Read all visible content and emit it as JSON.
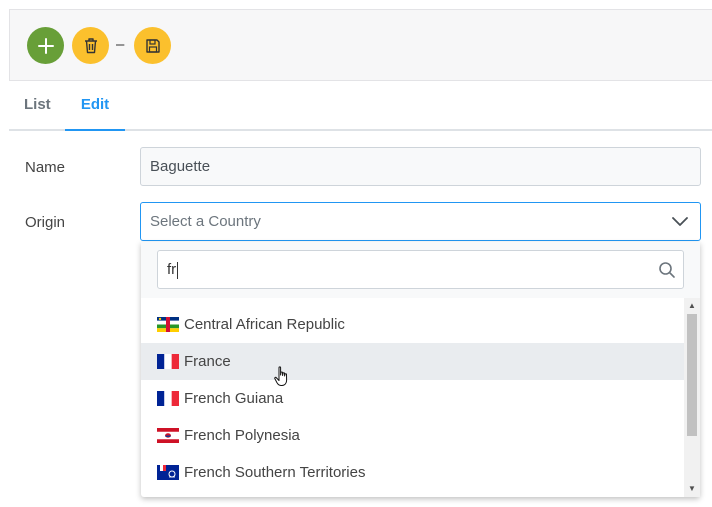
{
  "toolbar": {
    "add_icon": "plus-icon",
    "delete_icon": "trash-icon",
    "separator": "–",
    "save_icon": "save-icon",
    "colors": {
      "add": "#689f38",
      "warning": "#fbc02d"
    }
  },
  "tabs": [
    {
      "label": "List"
    },
    {
      "label": "Edit"
    }
  ],
  "form": {
    "name_label": "Name",
    "name_value": "Baguette",
    "origin_label": "Origin",
    "origin_placeholder": "Select a Country"
  },
  "dropdown": {
    "filter_value": "fr",
    "items": [
      {
        "label": "Central African Republic",
        "flag": "cf-flag-icon"
      },
      {
        "label": "France",
        "flag": "fr-flag-icon"
      },
      {
        "label": "French Guiana",
        "flag": "gf-flag-icon"
      },
      {
        "label": "French Polynesia",
        "flag": "pf-flag-icon"
      },
      {
        "label": "French Southern Territories",
        "flag": "tf-flag-icon"
      }
    ]
  },
  "accent_color": "#2196f3"
}
